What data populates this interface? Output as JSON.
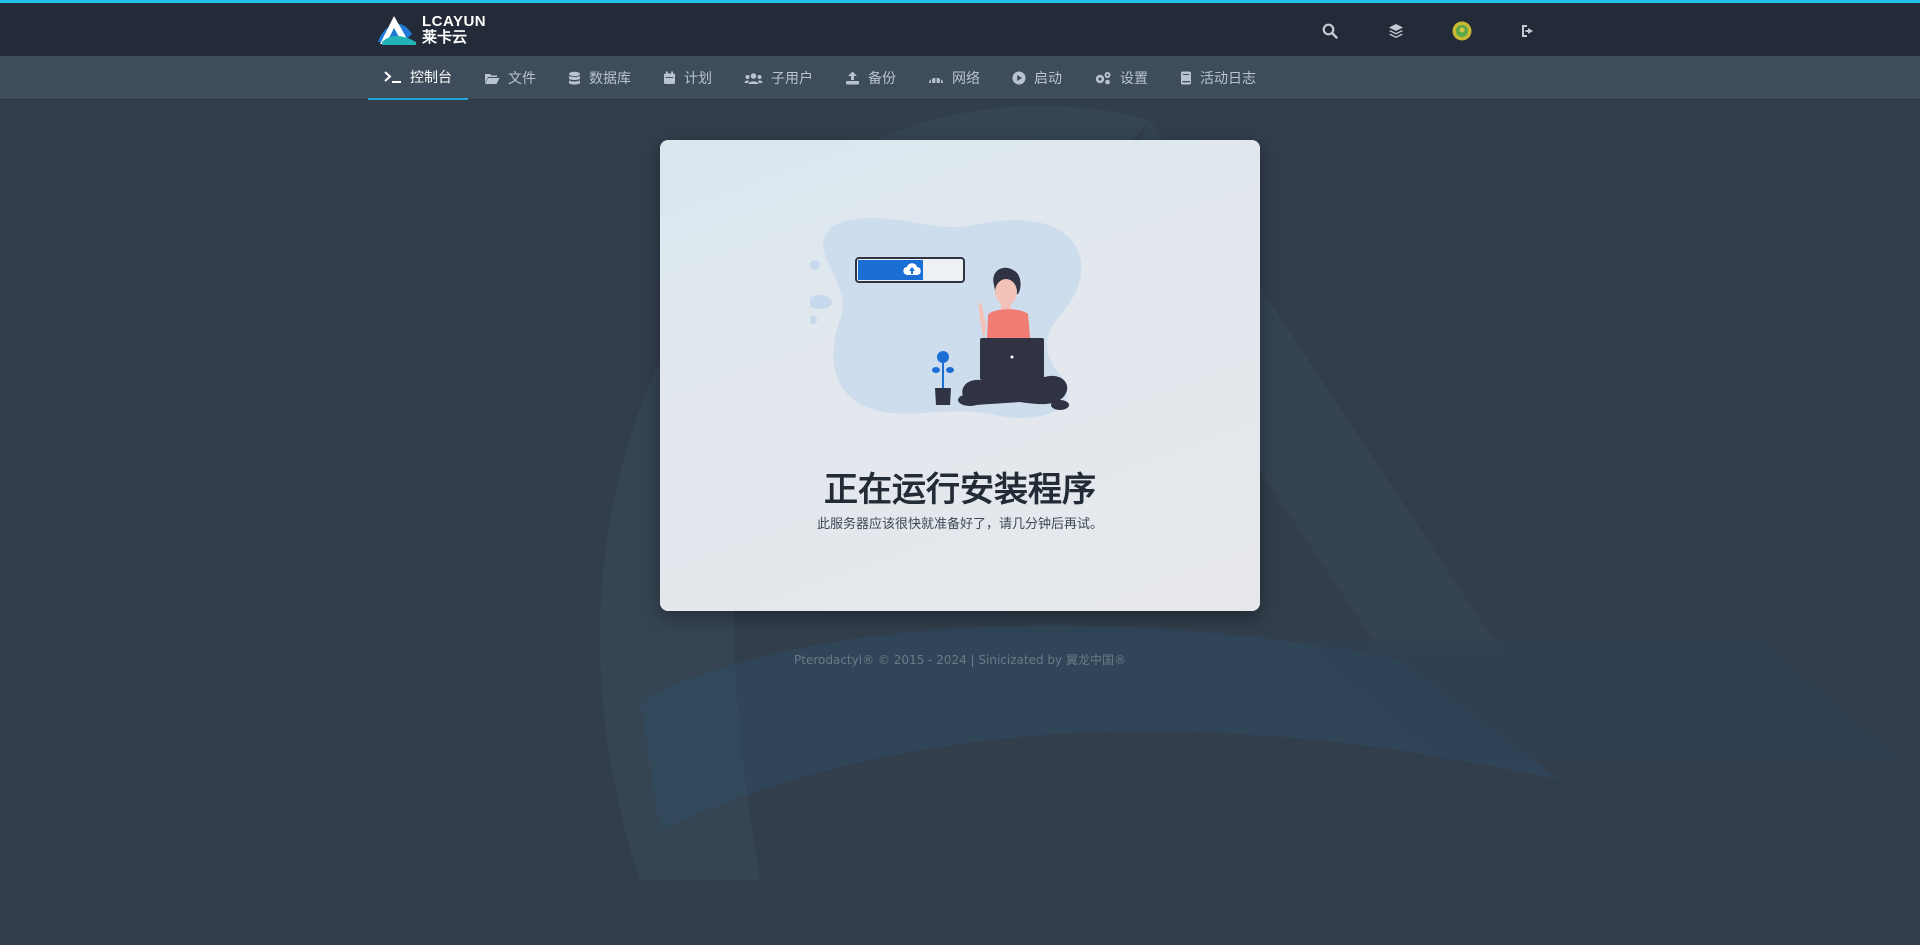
{
  "brand": {
    "name_en": "LCAYUN",
    "name_cn": "莱卡云"
  },
  "top_icons": [
    "search-icon",
    "layers-icon",
    "user-avatar",
    "sign-out-icon"
  ],
  "nav": {
    "items": [
      {
        "label": "控制台",
        "icon": "terminal-icon"
      },
      {
        "label": "文件",
        "icon": "folder-open-icon"
      },
      {
        "label": "数据库",
        "icon": "database-icon"
      },
      {
        "label": "计划",
        "icon": "calendar-icon"
      },
      {
        "label": "子用户",
        "icon": "users-icon"
      },
      {
        "label": "备份",
        "icon": "upload-icon"
      },
      {
        "label": "网络",
        "icon": "network-icon"
      },
      {
        "label": "启动",
        "icon": "play-circle-icon"
      },
      {
        "label": "设置",
        "icon": "cogs-icon"
      },
      {
        "label": "活动日志",
        "icon": "book-icon"
      }
    ],
    "active_index": 0
  },
  "card": {
    "title": "正在运行安装程序",
    "subtitle": "此服务器应该很快就准备好了，请几分钟后再试。"
  },
  "footer": {
    "text": "Pterodactyl® © 2015 - 2024 | Sinicizated by 翼龙中国®"
  },
  "colors": {
    "accent": "#21c3e8",
    "progress": "#1b6fd4",
    "shirt": "#f07c74",
    "dark": "#2f3343"
  }
}
